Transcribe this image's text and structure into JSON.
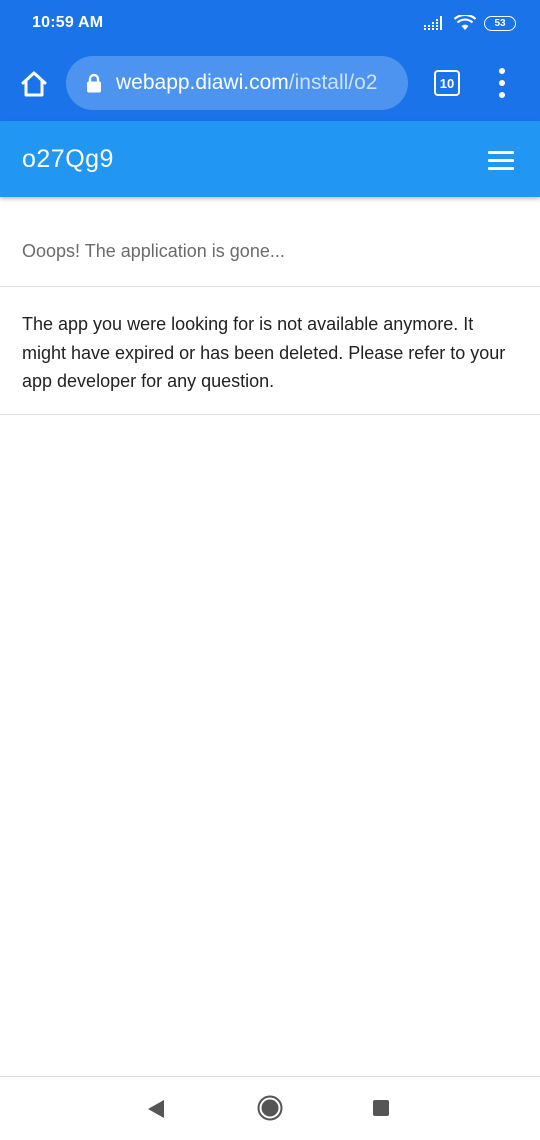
{
  "status_bar": {
    "time": "10:59 AM",
    "battery": "53",
    "icons": [
      "signal-icon",
      "wifi-icon",
      "battery-icon"
    ]
  },
  "browser": {
    "url_host": "webapp.diawi.com",
    "url_path": "/install/o2",
    "tab_count": "10",
    "icons": [
      "home-icon",
      "lock-icon",
      "tabs-icon",
      "more-vert-icon"
    ]
  },
  "app_header": {
    "title": "o27Qg9",
    "menu_icon": "hamburger-icon"
  },
  "content": {
    "heading": "Ooops! The application is gone...",
    "body": "The app you were looking for is not available anymore. It might have expired or has been deleted. Please refer to your app developer for any question."
  },
  "nav_bar": {
    "icons": [
      "back-icon",
      "home-circle-icon",
      "recents-icon"
    ]
  },
  "colors": {
    "browser_blue": "#1a73e8",
    "url_pill": "#4d94f0",
    "app_header_blue": "#2196f3",
    "heading_gray": "#6b6b6b",
    "body_text": "#222222"
  }
}
